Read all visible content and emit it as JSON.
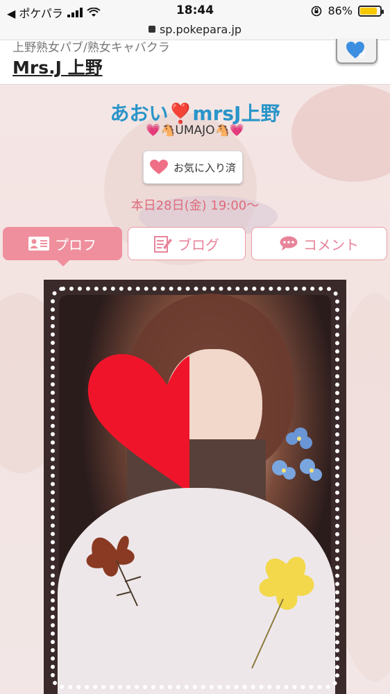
{
  "status_bar": {
    "back_label": "◀ ポケパラ",
    "time": "18:44",
    "battery_percent": "86%",
    "battery_level": 0.86
  },
  "url_bar": {
    "url": "sp.pokepara.jp"
  },
  "shop": {
    "category": "上野熟女パブ/熟女キャバクラ",
    "name": "Mrs.J 上野"
  },
  "girl": {
    "name_prefix": "あおい",
    "name_mark": "❣️",
    "name_suffix": "mrsJ上野",
    "tagline": "💗🐴UMAJO🐴💗",
    "favorite_label": "お気に入り済",
    "schedule": "本日28日(金) 19:00〜"
  },
  "tabs": [
    {
      "label": "プロフ",
      "icon": "profile-card-icon"
    },
    {
      "label": "ブログ",
      "icon": "blog-edit-icon"
    },
    {
      "label": "コメント",
      "icon": "comment-bubble-icon"
    }
  ],
  "colors": {
    "accent_pink": "#ef8f9d",
    "name_blue": "#2a95c9",
    "schedule_pink": "#e06a7c",
    "heart_red": "#f0142a"
  }
}
